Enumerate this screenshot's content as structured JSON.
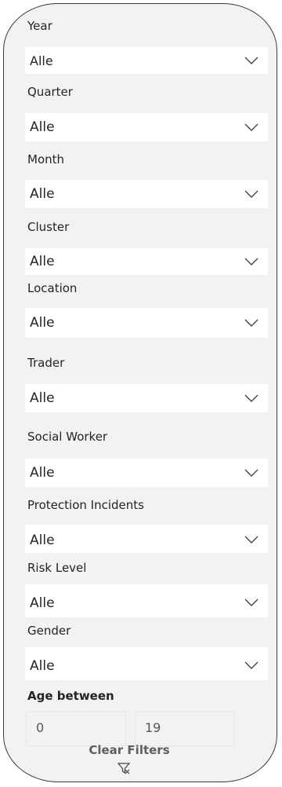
{
  "filters": [
    {
      "label": "Year",
      "value": "Alle"
    },
    {
      "label": "Quarter",
      "value": "Alle"
    },
    {
      "label": "Month",
      "value": "Alle"
    },
    {
      "label": "Cluster",
      "value": "Alle"
    },
    {
      "label": "Location",
      "value": "Alle"
    },
    {
      "label": "Trader",
      "value": "Alle"
    },
    {
      "label": "Social Worker",
      "value": "Alle"
    },
    {
      "label": "Protection Incidents",
      "value": "Alle"
    },
    {
      "label": "Risk Level",
      "value": "Alle"
    },
    {
      "label": "Gender",
      "value": "Alle"
    }
  ],
  "age": {
    "label": "Age between",
    "min": "0",
    "max": "19"
  },
  "clear": {
    "label": "Clear Filters",
    "icon": "clear-filter-icon"
  },
  "colors": {
    "panel_bg": "#f2f2f2",
    "border": "#3a3a3a",
    "text": "#252423"
  }
}
